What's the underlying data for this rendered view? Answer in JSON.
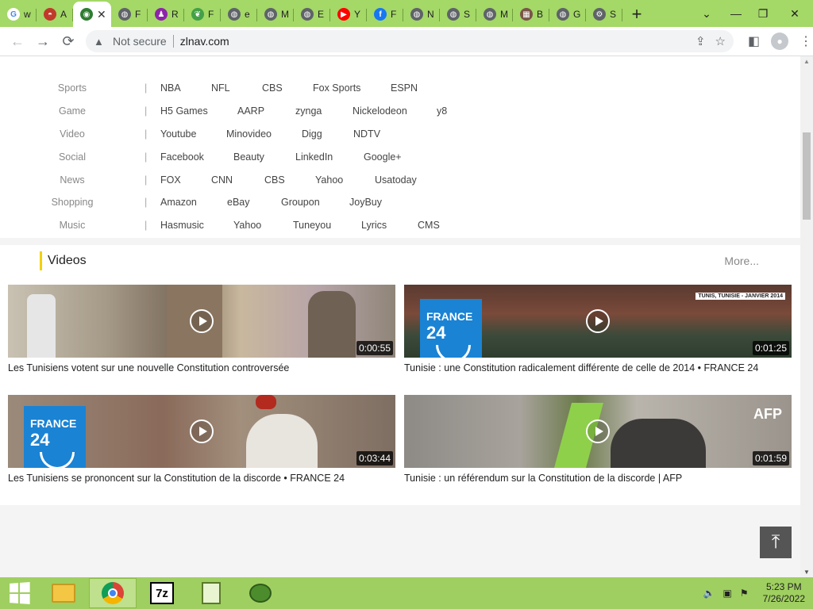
{
  "browser": {
    "tabs": [
      {
        "title": "w",
        "icon": "google-icon",
        "color": "#ffffff"
      },
      {
        "title": "A",
        "icon": "pokeball-icon",
        "color": "#c0392b"
      },
      {
        "title": "",
        "icon": "zlnav-icon",
        "color": "#2e7d32",
        "active": true
      },
      {
        "title": "F",
        "icon": "globe-icon",
        "color": "#5f6368"
      },
      {
        "title": "R",
        "icon": "pawn-icon",
        "color": "#8e24aa"
      },
      {
        "title": "F",
        "icon": "leaf-icon",
        "color": "#43a047"
      },
      {
        "title": "e",
        "icon": "globe-icon",
        "color": "#5f6368"
      },
      {
        "title": "M",
        "icon": "globe-icon",
        "color": "#5f6368"
      },
      {
        "title": "E",
        "icon": "globe-icon",
        "color": "#5f6368"
      },
      {
        "title": "Y",
        "icon": "youtube-icon",
        "color": "#ff0000"
      },
      {
        "title": "F",
        "icon": "facebook-icon",
        "color": "#1877f2"
      },
      {
        "title": "N",
        "icon": "globe-icon",
        "color": "#5f6368"
      },
      {
        "title": "S",
        "icon": "globe-icon",
        "color": "#5f6368"
      },
      {
        "title": "M",
        "icon": "globe-icon",
        "color": "#5f6368"
      },
      {
        "title": "B",
        "icon": "image-icon",
        "color": "#795548"
      },
      {
        "title": "G",
        "icon": "globe-icon",
        "color": "#5f6368"
      },
      {
        "title": "S",
        "icon": "gear-icon",
        "color": "#5f6368"
      }
    ],
    "security_label": "Not secure",
    "url": "zlnav.com"
  },
  "links": [
    {
      "category": "Sports",
      "items": [
        "NBA",
        "NFL",
        "CBS",
        "Fox Sports",
        "ESPN"
      ]
    },
    {
      "category": "Game",
      "items": [
        "H5 Games",
        "AARP",
        "zynga",
        "Nickelodeon",
        "y8"
      ]
    },
    {
      "category": "Video",
      "items": [
        "Youtube",
        "Minovideo",
        "Digg",
        "NDTV"
      ]
    },
    {
      "category": "Social",
      "items": [
        "Facebook",
        "Beauty",
        "LinkedIn",
        "Google+"
      ]
    },
    {
      "category": "News",
      "items": [
        "FOX",
        "CNN",
        "CBS",
        "Yahoo",
        "Usatoday"
      ]
    },
    {
      "category": "Shopping",
      "items": [
        "Amazon",
        "eBay",
        "Groupon",
        "JoyBuy"
      ]
    },
    {
      "category": "Music",
      "items": [
        "Hasmusic",
        "Yahoo",
        "Tuneyou",
        "Lyrics",
        "CMS"
      ]
    }
  ],
  "videos": {
    "heading": "Videos",
    "more_label": "More...",
    "items": [
      {
        "title": "Les Tunisiens votent sur une nouvelle Constitution controversée",
        "duration": "0:00:55"
      },
      {
        "title": "Tunisie : une Constitution radicalement différente de celle de 2014 • FRANCE 24",
        "duration": "0:01:25"
      },
      {
        "title": "Les Tunisiens se prononcent sur la Constitution de la discorde • FRANCE 24",
        "duration": "0:03:44"
      },
      {
        "title": "Tunisie : un référendum sur la Constitution de la discorde | AFP",
        "duration": "0:01:59"
      }
    ],
    "thumb_labels": {
      "france24_line1": "FRANCE",
      "france24_line2": "24",
      "tunis_caption": "TUNIS, TUNISIE - JANVIER 2014",
      "afp": "AFP"
    }
  },
  "taskbar": {
    "apps": [
      "chrome-icon",
      "file-explorer-icon",
      "7zip-icon",
      "notepad-icon",
      "network-icon"
    ],
    "time": "5:23 PM",
    "date": "7/26/2022"
  },
  "colors": {
    "chrome_frame": "#a4d867",
    "taskbar": "#9fcf60",
    "videos_accent": "#f2d100"
  }
}
